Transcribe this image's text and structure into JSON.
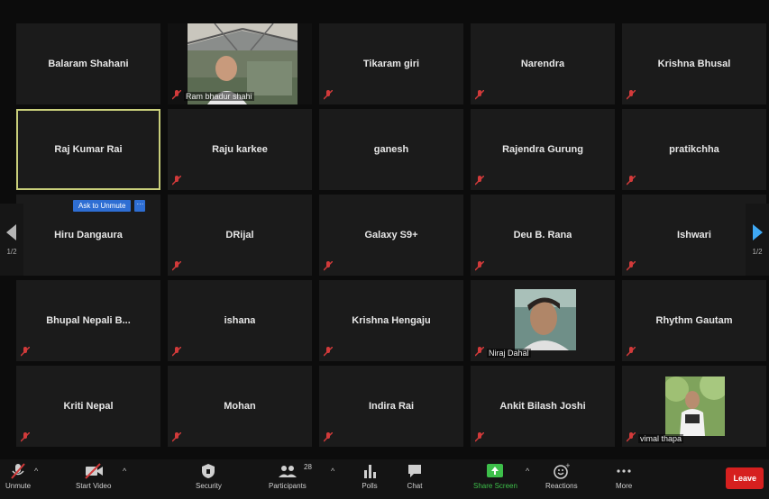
{
  "participants": [
    {
      "name": "Balaram Shahani"
    },
    {
      "name": "",
      "video_label": "Ram bhadur shahi"
    },
    {
      "name": "Tikaram giri"
    },
    {
      "name": "Narendra"
    },
    {
      "name": "Krishna Bhusal"
    },
    {
      "name": "Raj Kumar Rai"
    },
    {
      "name": "Raju karkee"
    },
    {
      "name": "ganesh"
    },
    {
      "name": "Rajendra Gurung"
    },
    {
      "name": "pratikchha"
    },
    {
      "name": "Hiru Dangaura"
    },
    {
      "name": "DRijal"
    },
    {
      "name": "Galaxy S9+"
    },
    {
      "name": "Deu B. Rana"
    },
    {
      "name": "Ishwari"
    },
    {
      "name": "Bhupal Nepali B..."
    },
    {
      "name": "ishana"
    },
    {
      "name": "Krishna Hengaju"
    },
    {
      "name": "",
      "video_label": "Niraj Dahal"
    },
    {
      "name": "Rhythm Gautam"
    },
    {
      "name": "Kriti Nepal"
    },
    {
      "name": "Mohan"
    },
    {
      "name": "Indira Rai"
    },
    {
      "name": "Ankit Bilash Joshi"
    },
    {
      "name": "",
      "video_label": "vimal thapa"
    }
  ],
  "ask_to_unmute": {
    "label": "Ask to Unmute",
    "more": "···"
  },
  "pagination": {
    "left": "1/2",
    "right": "1/2"
  },
  "toolbar": {
    "unmute": "Unmute",
    "start_video": "Start Video",
    "security": "Security",
    "participants": "Participants",
    "participants_count": "28",
    "polls": "Polls",
    "chat": "Chat",
    "share_screen": "Share Screen",
    "reactions": "Reactions",
    "more": "More",
    "leave": "Leave"
  },
  "colors": {
    "accent_green": "#3dbf4a",
    "leave_red": "#d6201f",
    "ask_blue": "#2e6ed3",
    "mute_red": "#d23a3a"
  }
}
